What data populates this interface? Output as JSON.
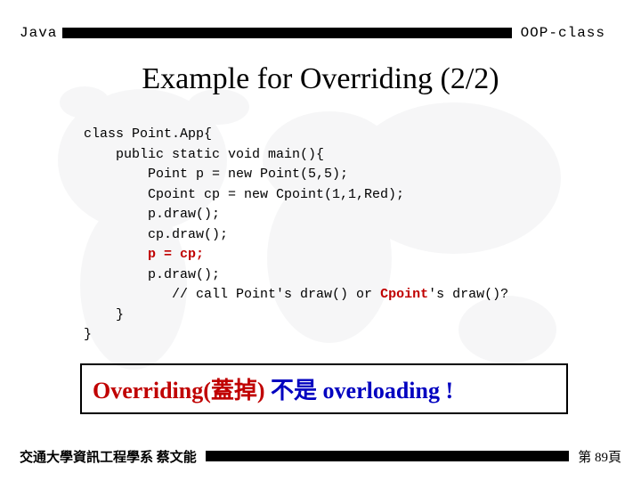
{
  "header": {
    "left_label": "Java",
    "right_label": "OOP-class"
  },
  "title": "Example for Overriding (2/2)",
  "code": {
    "l1": "class Point.App{",
    "l2": "    public static void main(){",
    "l3": "        Point p = new Point(5,5);",
    "l4": "        Cpoint cp = new Cpoint(1,1,Red);",
    "l5": "        p.draw();",
    "l6": "        cp.draw();",
    "l7_red": "        p = cp;",
    "l8": "        p.draw();",
    "l9a": "           // call Point's draw() or ",
    "l9b_red": "Cpoint",
    "l9c": "'s draw()?",
    "l10": "    }",
    "l11": "}"
  },
  "callout": {
    "red": "Overriding(蓋掉) ",
    "blue": "不是 overloading !"
  },
  "footer": {
    "left": "交通大學資訊工程學系 蔡文能",
    "right": "第 89頁"
  }
}
